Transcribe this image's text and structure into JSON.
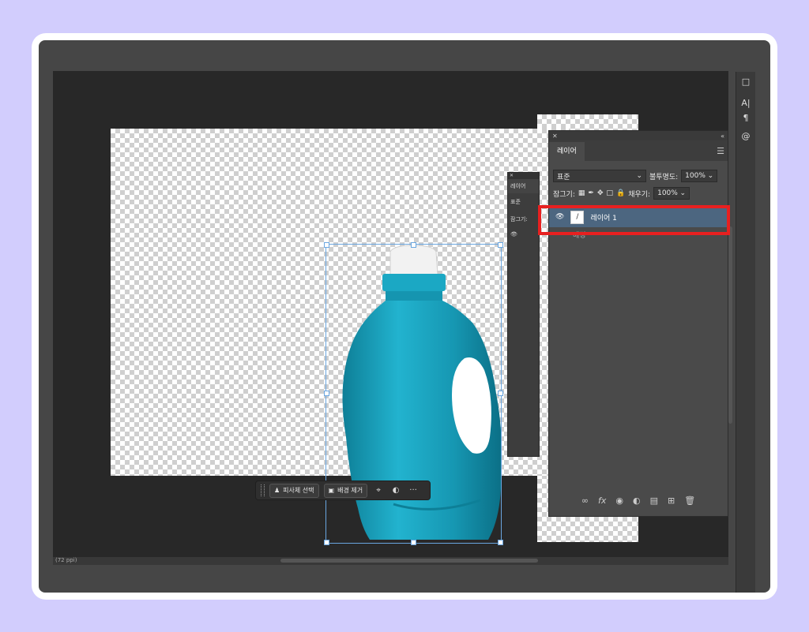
{
  "context_bar": {
    "select_subject": "피사체 선택",
    "remove_background": "배경 제거",
    "more": "···"
  },
  "mini_panel": {
    "tab": "레이어",
    "blend": "표준",
    "lock": "잠그기:"
  },
  "layers_panel": {
    "tab": "레이어",
    "blend_mode": "표준",
    "opacity_label": "불투명도:",
    "opacity_value": "100%",
    "lock_label": "잠그기:",
    "fill_label": "채우기:",
    "fill_value": "100%",
    "layers": [
      {
        "name": "레이어 1",
        "selected": true
      },
      {
        "name": "배경",
        "selected": false
      }
    ],
    "footer_icons": [
      "link-icon",
      "fx-icon",
      "mask-icon",
      "adjustment-icon",
      "folder-icon",
      "new-layer-icon",
      "trash-icon"
    ]
  },
  "status": {
    "zoom": "(72 ppi)"
  },
  "colors": {
    "accent": "#4c6680",
    "highlight": "#e82020",
    "bottle": "#1aa3bf"
  }
}
